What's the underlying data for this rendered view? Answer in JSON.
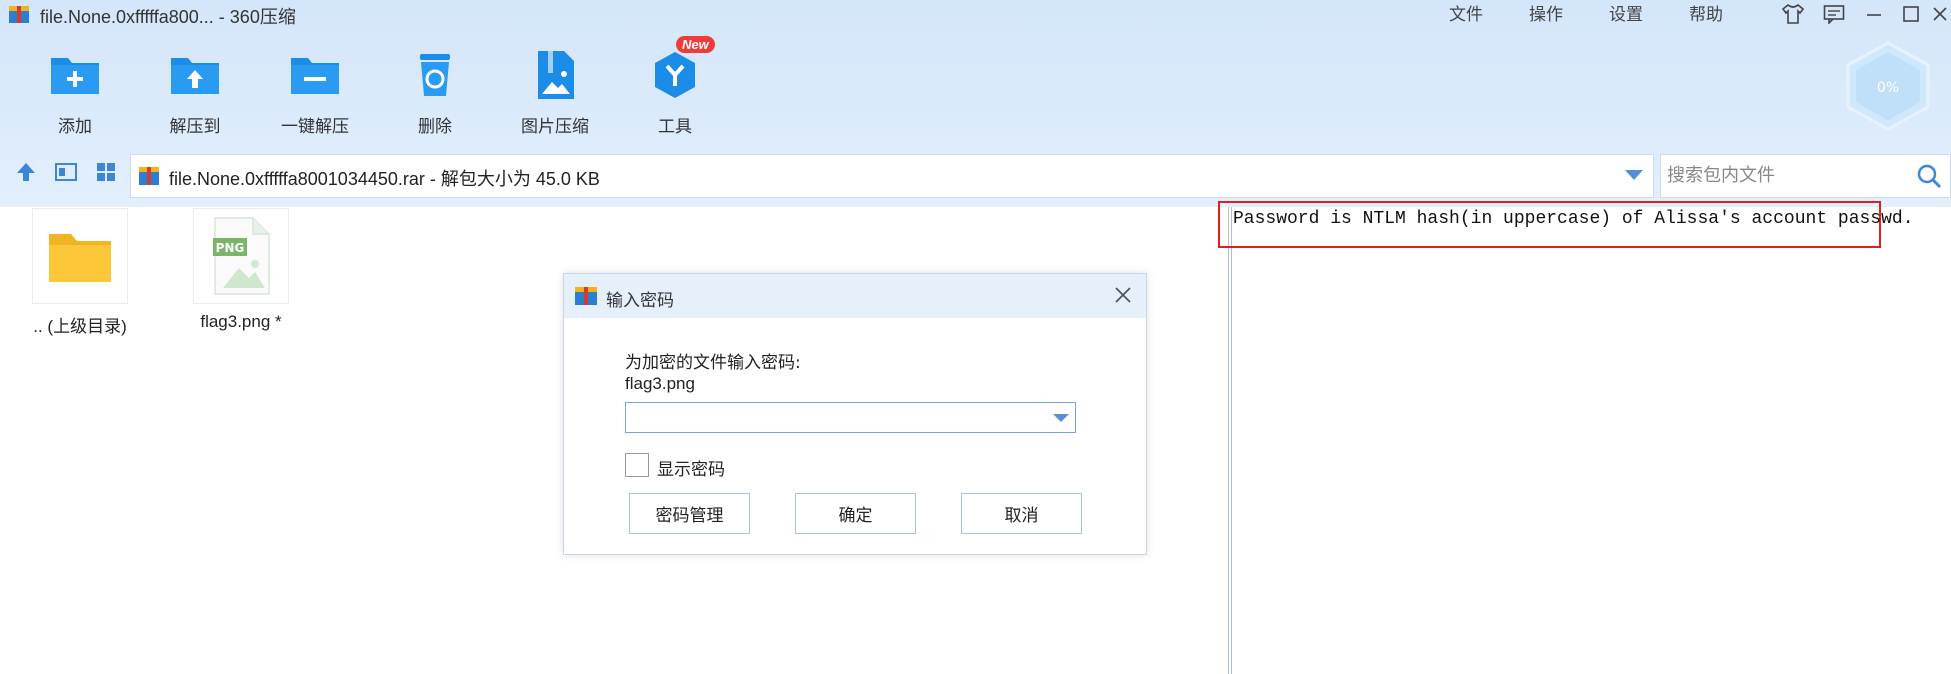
{
  "window": {
    "title": "file.None.0xfffffa800... - 360压缩",
    "menu": [
      "文件",
      "操作",
      "设置",
      "帮助"
    ],
    "controls": [
      "skin-icon",
      "feedback-icon",
      "minimize-icon",
      "maximize-icon",
      "close-icon"
    ]
  },
  "toolbar": {
    "buttons": [
      {
        "label": "添加",
        "icon": "add-folder-icon"
      },
      {
        "label": "解压到",
        "icon": "extract-to-icon"
      },
      {
        "label": "一键解压",
        "icon": "one-click-extract-icon"
      },
      {
        "label": "删除",
        "icon": "delete-icon"
      },
      {
        "label": "图片压缩",
        "icon": "image-compress-icon"
      },
      {
        "label": "工具",
        "icon": "tools-icon"
      }
    ],
    "new_badge": "New",
    "progress_badge": "0%"
  },
  "address_bar": {
    "path": "file.None.0xfffffa8001034450.rar",
    "info": " - 解包大小为 45.0 KB"
  },
  "search": {
    "placeholder": "搜索包内文件"
  },
  "files": [
    {
      "name": ".. (上级目录)",
      "icon": "folder-icon"
    },
    {
      "name": "flag3.png *",
      "icon": "png-file-icon"
    }
  ],
  "comment": {
    "text": "Password is NTLM hash(in uppercase) of Alissa's account passwd."
  },
  "dialog": {
    "title": "输入密码",
    "prompt": "为加密的文件输入密码:",
    "file": "flag3.png",
    "password_value": "",
    "show_password_label": "显示密码",
    "buttons": {
      "manage": "密码管理",
      "ok": "确定",
      "cancel": "取消"
    }
  },
  "colors": {
    "accent": "#2a8ae0",
    "header_bg": "#d4e6fa",
    "highlight_border": "#e02020"
  }
}
